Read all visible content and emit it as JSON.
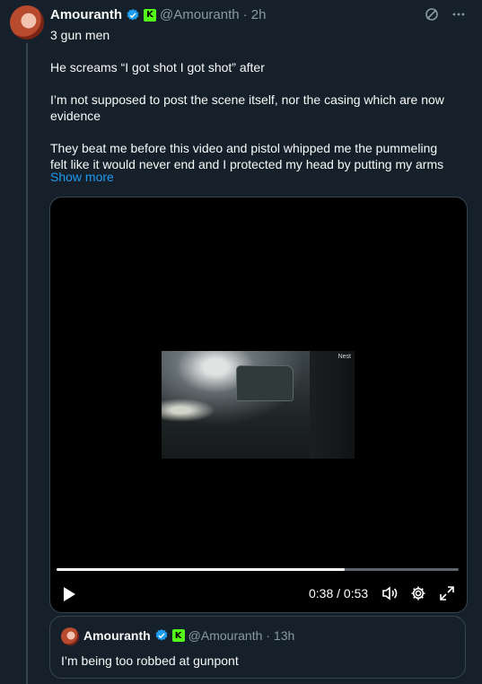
{
  "tweet": {
    "author_name": "Amouranth",
    "handle": "@Amouranth",
    "time": "· 2h",
    "kick_badge": "K",
    "paragraphs": [
      "3 gun men",
      "He screams “I got shot I got shot” after",
      "I’m not supposed to post the scene itself,  nor the casing which are now evidence",
      "They beat me before this video and pistol whipped me  the pummeling felt like it would never end and I protected  my head by putting my arms"
    ],
    "show_more": "Show more"
  },
  "video": {
    "overlay_label": "Nest",
    "time_display": "0:38 / 0:53",
    "progress_fraction": 0.717,
    "icons": [
      "play-icon",
      "volume-icon",
      "settings-icon",
      "fullscreen-icon"
    ]
  },
  "quote": {
    "author_name": "Amouranth",
    "handle": "@Amouranth",
    "time": "· 13h",
    "kick_badge": "K",
    "text": "I’m being too robbed at gunpont"
  },
  "colors": {
    "background": "#15202b",
    "accent": "#1d9bf0",
    "secondary_text": "#8b98a5",
    "kick_green": "#53fc18"
  }
}
